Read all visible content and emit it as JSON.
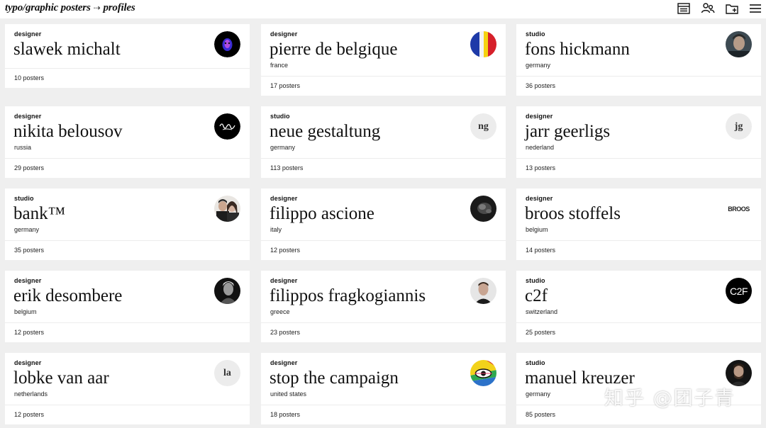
{
  "breadcrumb": {
    "root": "typo/graphic posters",
    "separator": "⇢",
    "current": "profiles"
  },
  "toolbar": {
    "icons": [
      "list-view-icon",
      "profiles-icon",
      "new-folder-icon",
      "menu-icon"
    ]
  },
  "profiles": [
    {
      "kind": "designer",
      "name": "slawek michalt",
      "country": "",
      "count": "10 posters",
      "avatar": {
        "type": "image",
        "icon": "mask-face-icon"
      }
    },
    {
      "kind": "designer",
      "name": "pierre de belgique",
      "country": "france",
      "count": "17 posters",
      "avatar": {
        "type": "image",
        "icon": "flag-icon"
      }
    },
    {
      "kind": "studio",
      "name": "fons hickmann",
      "country": "germany",
      "count": "36 posters",
      "avatar": {
        "type": "image",
        "icon": "portrait-icon"
      }
    },
    {
      "kind": "designer",
      "name": "nikita belousov",
      "country": "russia",
      "count": "29 posters",
      "avatar": {
        "type": "image",
        "icon": "signature-logo-icon"
      }
    },
    {
      "kind": "studio",
      "name": "neue gestaltung",
      "country": "germany",
      "count": "113 posters",
      "avatar": {
        "type": "initials",
        "text": "ng"
      }
    },
    {
      "kind": "designer",
      "name": "jarr geerligs",
      "country": "nederland",
      "count": "13 posters",
      "avatar": {
        "type": "initials",
        "text": "jg"
      }
    },
    {
      "kind": "studio",
      "name": "bank™",
      "country": "germany",
      "count": "35 posters",
      "avatar": {
        "type": "image",
        "icon": "duo-portrait-icon"
      }
    },
    {
      "kind": "designer",
      "name": "filippo ascione",
      "country": "italy",
      "count": "12 posters",
      "avatar": {
        "type": "image",
        "icon": "dark-photo-icon"
      }
    },
    {
      "kind": "designer",
      "name": "broos stoffels",
      "country": "belgium",
      "count": "14 posters",
      "avatar": {
        "type": "wordmark",
        "text": "BROOS"
      }
    },
    {
      "kind": "designer",
      "name": "erik desombere",
      "country": "belgium",
      "count": "12 posters",
      "avatar": {
        "type": "image",
        "icon": "bw-portrait-icon"
      }
    },
    {
      "kind": "designer",
      "name": "filippos fragkogiannis",
      "country": "greece",
      "count": "23 posters",
      "avatar": {
        "type": "image",
        "icon": "portrait-icon"
      }
    },
    {
      "kind": "studio",
      "name": "c2f",
      "country": "switzerland",
      "count": "25 posters",
      "avatar": {
        "type": "wordmark-dark",
        "text": "C2F"
      }
    },
    {
      "kind": "designer",
      "name": "lobke van aar",
      "country": "netherlands",
      "count": "12 posters",
      "avatar": {
        "type": "initials",
        "text": "la"
      }
    },
    {
      "kind": "designer",
      "name": "stop the campaign",
      "country": "united states",
      "count": "18 posters",
      "avatar": {
        "type": "image",
        "icon": "eye-logo-icon"
      }
    },
    {
      "kind": "studio",
      "name": "manuel kreuzer",
      "country": "germany",
      "count": "85 posters",
      "avatar": {
        "type": "image",
        "icon": "portrait-icon"
      }
    }
  ],
  "watermark": "知乎 @团子青",
  "colors": {
    "background": "#efefef",
    "card": "#ffffff",
    "text": "#111111"
  }
}
